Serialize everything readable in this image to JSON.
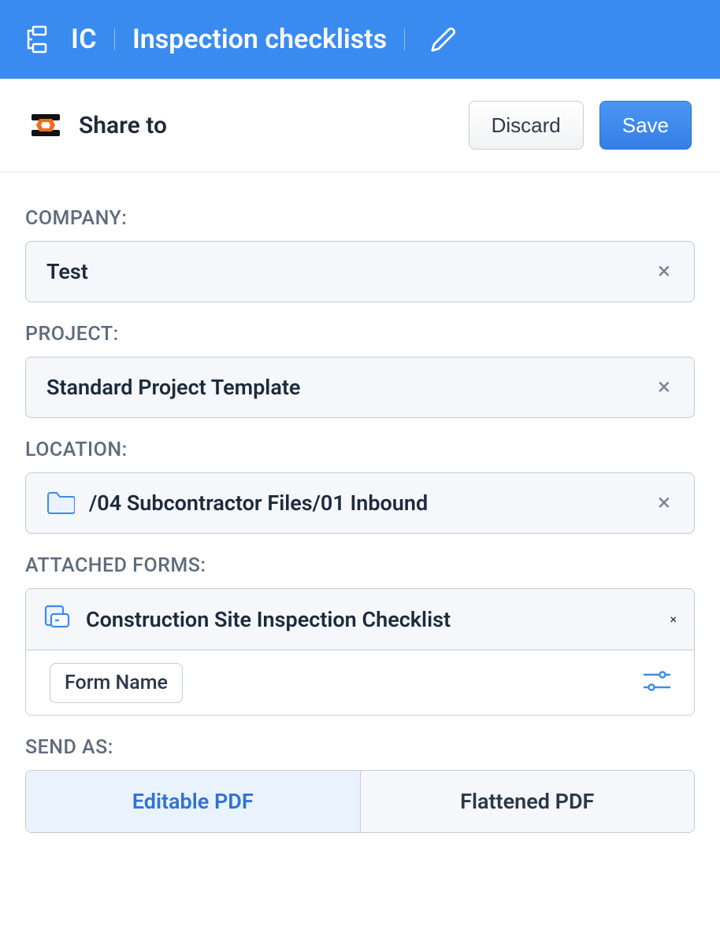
{
  "header": {
    "code": "IC",
    "title": "Inspection checklists"
  },
  "actions": {
    "share_label": "Share to",
    "discard_label": "Discard",
    "save_label": "Save"
  },
  "fields": {
    "company": {
      "label": "COMPANY:",
      "value": "Test"
    },
    "project": {
      "label": "PROJECT:",
      "value": "Standard Project Template"
    },
    "location": {
      "label": "LOCATION:",
      "value": "/04 Subcontractor Files/01 Inbound"
    },
    "attached_forms": {
      "label": "ATTACHED FORMS:",
      "item": "Construction Site Inspection Checklist",
      "chip": "Form Name"
    },
    "send_as": {
      "label": "SEND AS:",
      "option_a": "Editable PDF",
      "option_b": "Flattened PDF"
    }
  },
  "icons": {
    "clear": "×"
  },
  "colors": {
    "primary": "#3a8bf0",
    "text": "#1d2a3c",
    "muted": "#5e6b7d",
    "border": "#c4cbd5",
    "pill_bg": "#f5f7fa",
    "active_bg": "#eaf2fe"
  }
}
